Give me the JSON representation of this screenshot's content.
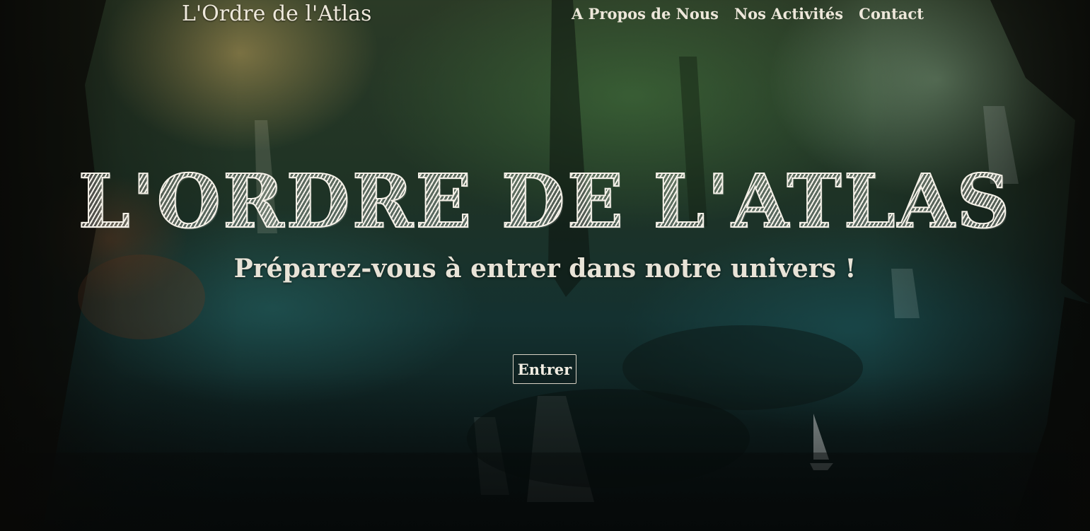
{
  "header": {
    "brand": "L'Ordre de l'Atlas",
    "nav": [
      {
        "label": "A Propos de Nous"
      },
      {
        "label": "Nos Activités"
      },
      {
        "label": "Contact"
      }
    ]
  },
  "hero": {
    "title": "L'ORDRE DE L'ATLAS",
    "subtitle": "Préparez-vous à entrer dans notre univers !",
    "button_label": "Entrer",
    "background_image": "forest-waterfall-landscape"
  },
  "colors": {
    "text": "#f0ece2",
    "overlay": "#0c1a1a",
    "button_border": "#d8d2c4"
  }
}
